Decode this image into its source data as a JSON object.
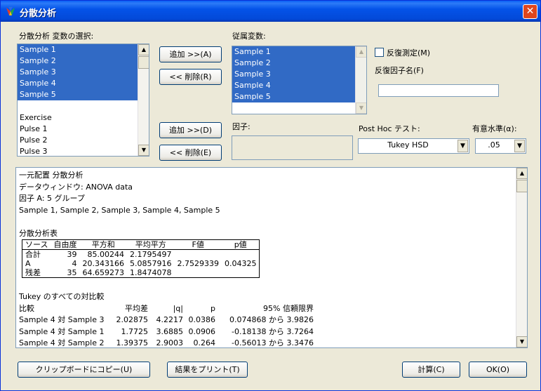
{
  "window": {
    "title": "分散分析",
    "close_label": "✕"
  },
  "variables": {
    "label": "分散分析 変数の選択:",
    "selected": [
      "Sample 1",
      "Sample 2",
      "Sample 3",
      "Sample 4",
      "Sample 5"
    ],
    "others": [
      "Exercise",
      "Pulse 1",
      "Pulse 2",
      "Pulse 3"
    ]
  },
  "mid_buttons": {
    "add1": "追加 >>(A)",
    "remove1": "<< 削除(R)",
    "add2": "追加 >>(D)",
    "remove2": "<< 削除(E)"
  },
  "dependent": {
    "label": "従属変数:",
    "items": [
      "Sample 1",
      "Sample 2",
      "Sample 3",
      "Sample 4",
      "Sample 5"
    ]
  },
  "repeated": {
    "checkbox_label": "反復測定(M)",
    "checked": false,
    "factor_name_label": "反復因子名(F)",
    "factor_name_value": ""
  },
  "factor": {
    "label": "因子:",
    "value": ""
  },
  "posthoc": {
    "label": "Post Hoc テスト:",
    "selected": "Tukey HSD"
  },
  "significance": {
    "label": "有意水準(α):",
    "selected": ".05"
  },
  "output": {
    "lines": [
      "一元配置 分散分析",
      "データウィンドウ: ANOVA data",
      "因子 A: 5 グループ",
      "Sample 1, Sample 2, Sample 3, Sample 4, Sample 5"
    ],
    "anova_title": "分散分析表",
    "anova_headers": [
      "ソース",
      "自由度",
      "平方和",
      "平均平方",
      "F値",
      "p値"
    ],
    "anova_rows": [
      [
        "合計",
        "39",
        "85.00244",
        "2.1795497",
        "",
        ""
      ],
      [
        "A",
        "4",
        "20.343166",
        "5.0857916",
        "2.7529339",
        "0.04325"
      ],
      [
        "残差",
        "35",
        "64.659273",
        "1.8474078",
        "",
        ""
      ]
    ],
    "tukey_title": "Tukey のすべての対比較",
    "tukey_headers": [
      "比較",
      "平均差",
      "|q|",
      "p",
      "95% 信頼限界"
    ],
    "tukey_rows": [
      [
        "Sample 4 対 Sample 3",
        "2.02875",
        "4.2217",
        "0.0386",
        "0.074868 から 3.9826"
      ],
      [
        "Sample 4 対 Sample 1",
        "1.7725",
        "3.6885",
        "0.0906",
        "-0.18138 から 3.7264"
      ],
      [
        "Sample 4 対 Sample 2",
        "1.39375",
        "2.9003",
        "0.264",
        "-0.56013 から 3.3476"
      ]
    ]
  },
  "bottom_buttons": {
    "copy": "クリップボードにコピー(U)",
    "print": "結果をプリント(T)",
    "calc": "計算(C)",
    "ok": "OK(O)"
  },
  "colors": {
    "selection": "#316ac5",
    "titlebar": "#0453e8",
    "dialog_bg": "#ece9d8"
  }
}
